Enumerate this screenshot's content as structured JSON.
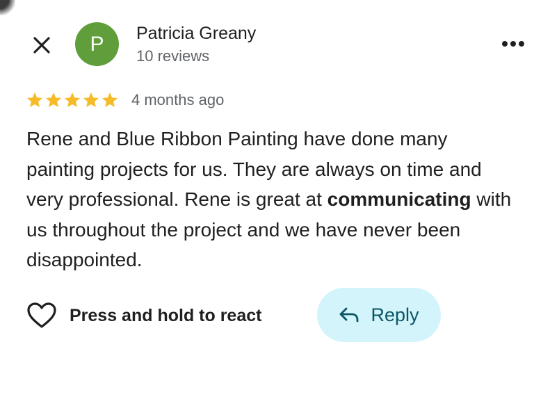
{
  "colors": {
    "avatar_bg": "#5f9e3a",
    "star": "#f6bb28",
    "reply_bg": "#d3f4fb",
    "reply_fg": "#0b5566"
  },
  "header": {
    "close_icon": "close-icon",
    "avatar_initial": "P",
    "author_name": "Patricia Greany",
    "review_count": "10 reviews",
    "more_icon": "more-horizontal-icon"
  },
  "review": {
    "rating": 5,
    "max_rating": 5,
    "date": "4 months ago",
    "text_part1": "Rene and Blue Ribbon Painting have done many painting projects for us. They are always on time and very professional. Rene is great at ",
    "text_bold": "communicating",
    "text_part2": " with us throughout the project and we have never been disappointed."
  },
  "actions": {
    "react_icon": "heart-outline-icon",
    "react_label": "Press and hold to react",
    "reply_icon": "reply-arrow-icon",
    "reply_label": "Reply"
  }
}
